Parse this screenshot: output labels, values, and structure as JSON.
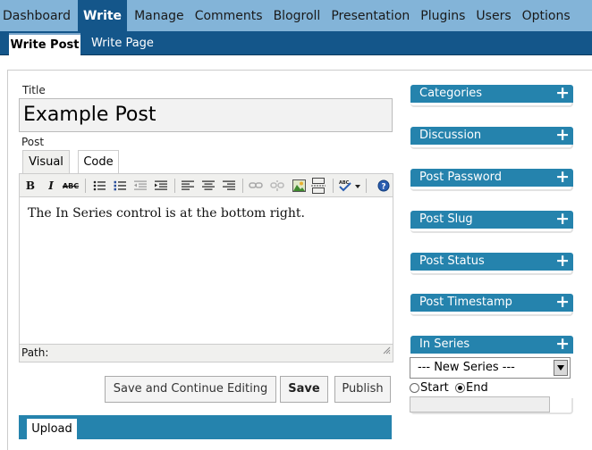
{
  "nav": {
    "items": [
      "Dashboard",
      "Write",
      "Manage",
      "Comments",
      "Blogroll",
      "Presentation",
      "Plugins",
      "Users",
      "Options"
    ],
    "active": "Write"
  },
  "subnav": {
    "items": [
      "Write Post",
      "Write Page"
    ],
    "active": "Write Post"
  },
  "form": {
    "title_label": "Title",
    "title_value": "Example Post",
    "post_label": "Post",
    "tabs": [
      "Visual",
      "Code"
    ],
    "active_tab": "Visual",
    "content": "The In Series control is at the bottom right.",
    "path_label": "Path:",
    "toolbar_icons": [
      "bold-icon",
      "italic-icon",
      "strikethrough-icon",
      "bullet-list-icon",
      "numbered-list-icon",
      "outdent-icon",
      "indent-icon",
      "align-left-icon",
      "align-center-icon",
      "align-right-icon",
      "link-icon",
      "unlink-icon",
      "image-icon",
      "more-break-icon",
      "spellcheck-icon",
      "help-icon"
    ],
    "bold_glyph": "B",
    "italic_glyph": "I",
    "strike_glyph": "ABC"
  },
  "buttons": {
    "save_continue": "Save and Continue Editing",
    "save": "Save",
    "publish": "Publish"
  },
  "upload": {
    "tab_label": "Upload"
  },
  "sidebar": {
    "boxes": [
      "Categories",
      "Discussion",
      "Post Password",
      "Post Slug",
      "Post Status",
      "Post Timestamp",
      "In Series"
    ],
    "toggle_glyph": "+"
  },
  "series": {
    "selected": "--- New Series ---",
    "start_label": "Start",
    "end_label": "End",
    "selected_radio": "End"
  },
  "colors": {
    "topnav_bg": "#83b4d8",
    "subnav_bg": "#14568a",
    "box_header": "#2583ad"
  }
}
